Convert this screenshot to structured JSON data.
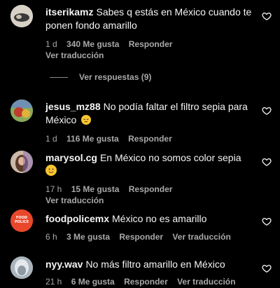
{
  "comments": [
    {
      "username": "itserikamz",
      "text": "Sabes q estás en México cuando te ponen fondo amarillo",
      "time": "1 d",
      "likes": "340 Me gusta",
      "reply": "Responder",
      "translate": "Ver traducción",
      "avatar_color": "#c9c2b6"
    },
    {
      "username": "jesus_mz88",
      "text": "No podía faltar el filtro sepia para México",
      "emoji": "😔",
      "time": "1 d",
      "likes": "116 Me gusta",
      "reply": "Responder",
      "avatar_color": "#6b8f4e"
    },
    {
      "username": "marysol.cg",
      "text": "En México no somos color sepia",
      "emoji": "🙂",
      "time": "17 h",
      "likes": "15 Me gusta",
      "reply": "Responder",
      "translate": "Ver traducción",
      "avatar_color": "#b98b78"
    },
    {
      "username": "foodpolicemx",
      "text": "México no es amarillo",
      "time": "6 h",
      "likes": "3 Me gusta",
      "reply": "Responder",
      "translate": "Ver traducción",
      "avatar_color": "#e8472b",
      "avatar_text": "FOOD POLICE"
    },
    {
      "username": "nyy.wav",
      "text": "No más filtro amarillo en México",
      "time": "21 h",
      "likes": "6 Me gusta",
      "reply": "Responder",
      "translate": "Ver traducción",
      "avatar_color": "#cfd6dc"
    }
  ],
  "view_replies": "Ver respuestas (9)",
  "colors": {
    "background": "#000000",
    "text": "#f5f5f5",
    "secondary": "#a8a8a8",
    "heart": "#f5f5f5"
  }
}
